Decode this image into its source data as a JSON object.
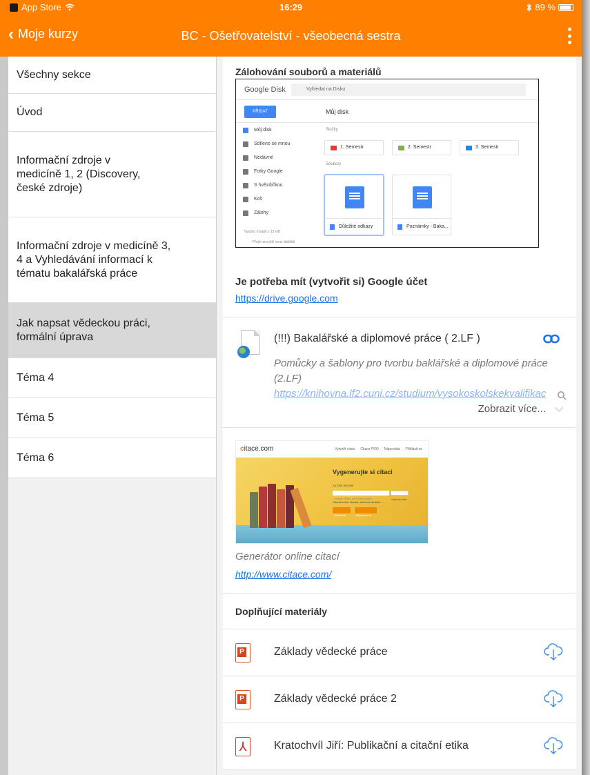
{
  "status_bar": {
    "app": "App Store",
    "wifi_icon": "wifi-icon",
    "time": "16:29",
    "bluetooth_icon": "bluetooth-icon",
    "battery": "89 %"
  },
  "nav": {
    "back_label": "Moje kurzy",
    "back_icon": "chevron-left-icon",
    "title": "BC - Ošetřovatelství - všeobecná sestra",
    "more_icon": "more-vertical-icon"
  },
  "sidebar": {
    "items": [
      {
        "label": "Všechny sekce",
        "active": false
      },
      {
        "label": "Úvod",
        "active": false
      },
      {
        "label": "Informační zdroje v medicíně 1, 2 (Discovery, české zdroje)",
        "active": false
      },
      {
        "label": "Informační zdroje v medicíně 3, 4 a Vyhledávání informací k tématu bakalářská práce",
        "active": false
      },
      {
        "label": "Jak napsat vědeckou práci, formální úprava",
        "active": true
      },
      {
        "label": "Téma 4",
        "active": false
      },
      {
        "label": "Téma 5",
        "active": false
      },
      {
        "label": "Téma 6",
        "active": false
      }
    ]
  },
  "backup": {
    "heading": "Zálohování souborů a materiálů",
    "note": "Je potřeba mít (vytvořit si) Google účet",
    "link": "https://drive.google.com",
    "drive_shot": {
      "logo": "Google Disk",
      "search_placeholder": "Vyhledat na Disku",
      "new_button": "PŘIDAT",
      "my_drive": "Můj disk",
      "nav": [
        "Můj disk",
        "Sdíleno se mnou",
        "Nedávné",
        "Fotky Google",
        "S hvězdičkou",
        "Koš",
        "Zálohy"
      ],
      "storage": "Využito 0 bajtů z 15 GB",
      "upgrade": "Přejít na vyšší verzi úložiště",
      "folders_label": "Složky",
      "files_label": "Soubory",
      "folders": [
        "1. Semestr",
        "2. Semestr",
        "3. Semestr"
      ],
      "files": [
        "Důležité odkazy",
        "Poznámky - Baka..."
      ]
    }
  },
  "theses_link": {
    "title": "(!!!) Bakalářské a diplomové práce ( 2.LF )",
    "link_icon": "link-icon",
    "description": "Pomůcky a šablony pro tvorbu baklářské a diplomové práce (2.LF)",
    "url": "https://knihovna.lf2.cuni.cz/studium/vysokoskolskekvalifikac",
    "show_more": "Zobrazit více..."
  },
  "citace": {
    "caption": "Generátor online citací",
    "link": "http://www.citace.com/",
    "image": {
      "brand_prefix": "c",
      "brand": "itace.com",
      "menu": [
        "Vytvořit citaci",
        "Citace PRO",
        "Nápověda",
        "Přihlásit se"
      ],
      "headline": "Vygenerujte si citaci",
      "sub": "Za ČSN ISO 690",
      "input_placeholder": "Zadejte ISBN, DOI nebo název",
      "search_btn": "Vyhledat citaci",
      "sub2": "Citovat knihu, článek, webovou stránku...",
      "register_btn": "Přihlásit se",
      "login_btn": "Registrovat se"
    }
  },
  "materials": {
    "heading": "Doplňující materiály",
    "items": [
      {
        "label": "Základy vědecké práce",
        "type": "ppt"
      },
      {
        "label": "Základy vědecké práce 2",
        "type": "ppt"
      },
      {
        "label": "Kratochvíl Jiří: Publikační a citační etika",
        "type": "pdf"
      }
    ]
  },
  "colors": {
    "accent": "#ff7f00",
    "link": "#1a73e8",
    "selected": "#d8d8d8"
  }
}
